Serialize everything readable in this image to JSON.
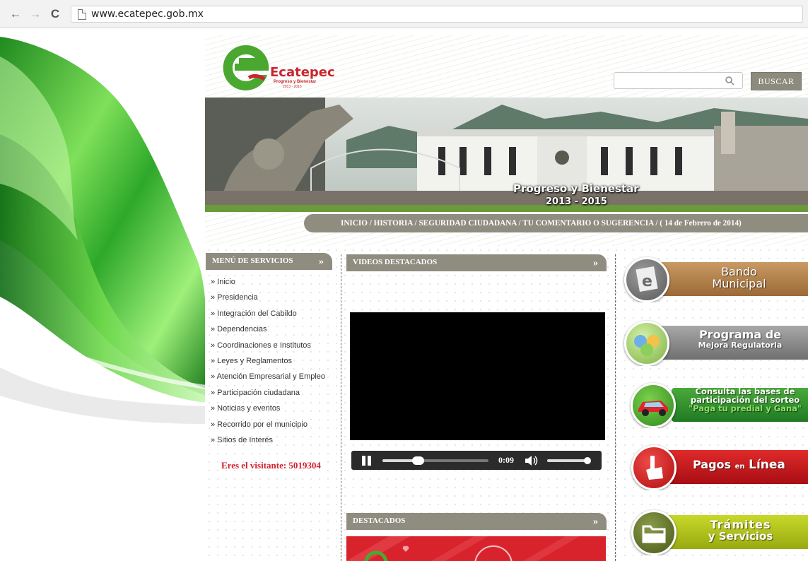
{
  "browser": {
    "url": "www.ecatepec.gob.mx",
    "back_icon": "←",
    "forward_icon": "→",
    "reload_icon": "C"
  },
  "header": {
    "logo_title": "Ecatepec",
    "logo_tagline": "Progreso y Bienestar",
    "logo_years": "2013 - 2015",
    "search_placeholder": "",
    "search_button": "BUSCAR"
  },
  "banner": {
    "slogan": "Progreso y Bienestar",
    "years": "2013 - 2015"
  },
  "navbar": {
    "text": "INICIO / HISTORIA / SEGURIDAD CIUDADANA / TU COMENTARIO O SUGERENCIA / ( 14 de Febrero de 2014)"
  },
  "menu": {
    "title": "MENÚ DE SERVICIOS",
    "arrow": "»",
    "items": [
      "» Inicio",
      "» Presidencia",
      "» Integración del Cabildo",
      "» Dependencias",
      "» Coordinaciones e Institutos",
      "» Leyes y Reglamentos",
      "» Atención Empresarial y Empleo",
      "» Participación ciudadana",
      "» Noticias y eventos",
      "» Recorrido por el municipio",
      "» Sitios de Interés"
    ],
    "visitors": "Eres el visitante: 5019304"
  },
  "videos": {
    "title": "VIDEOS DESTACADOS",
    "arrow": "»",
    "time": "0:09",
    "progress": 0.33,
    "volume": 0.95
  },
  "destacados": {
    "title": "DESTACADOS",
    "arrow": "»"
  },
  "sidebar": {
    "bando_line1": "Bando",
    "bando_line2": "Municipal",
    "programa_line1": "Programa de",
    "programa_line2": "Mejora Regulatoria",
    "sorteo_line1": "Consulta las bases de",
    "sorteo_line2": "participación del sorteo",
    "sorteo_line3": "\"Paga tu predial y Gana\"",
    "pagos_line1": "Pagos",
    "pagos_en": "en",
    "pagos_line2": "Línea",
    "tramites_line1": "Trámites",
    "tramites_line2": "y Servicios"
  },
  "colors": {
    "brand_green": "#4aa830",
    "brand_red": "#c8262f",
    "tab_gray": "#8f8c80"
  }
}
